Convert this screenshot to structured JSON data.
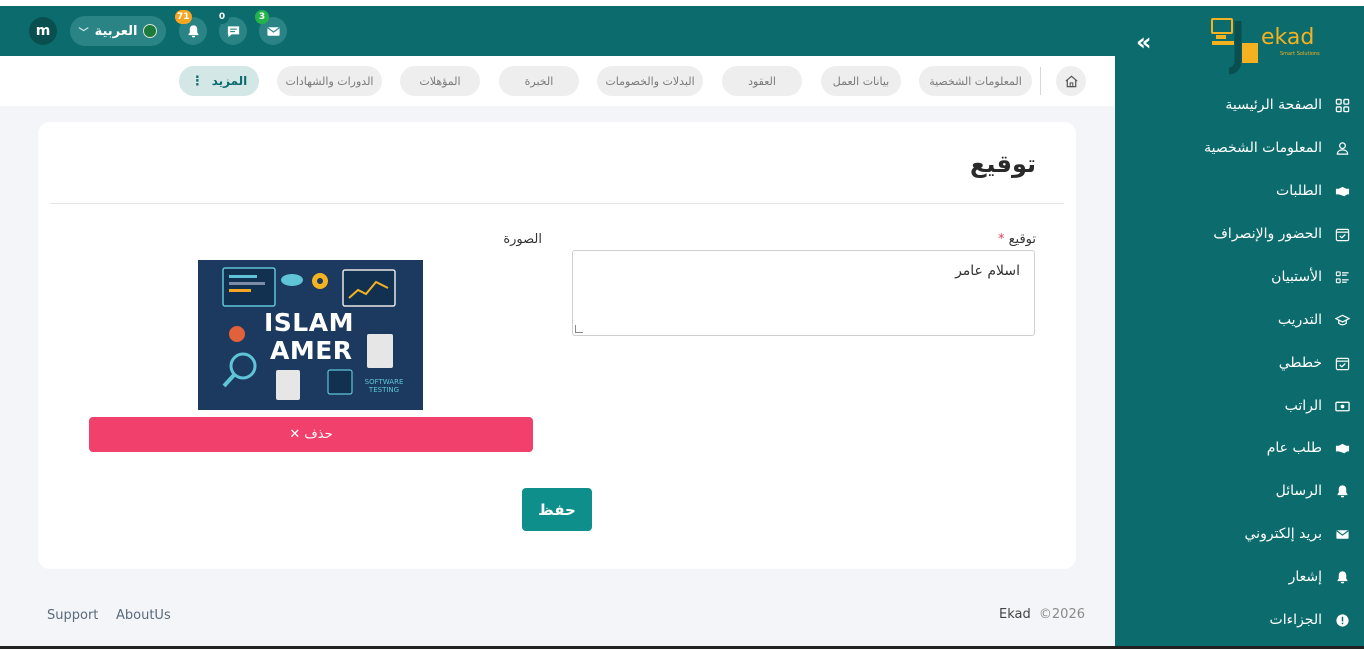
{
  "header": {
    "avatar_letter": "m",
    "language": "العربية",
    "notifications": [
      {
        "name": "notifications",
        "count": "71",
        "badge_color": "#f5a623"
      },
      {
        "name": "messages",
        "count": "0",
        "badge_color": "#0c6b6c"
      },
      {
        "name": "mail",
        "count": "3",
        "badge_color": "#23b34a"
      }
    ]
  },
  "tabs": {
    "home_icon": "home-icon",
    "items": [
      "المعلومات الشخصية",
      "بيانات العمل",
      "العقود",
      "البدلات والخصومات",
      "الخبرة",
      "المؤهلات",
      "الدورات والشهادات"
    ],
    "more_label": "المزيد"
  },
  "card": {
    "title": "توقيع",
    "signature_label": "توقيع",
    "required_mark": "*",
    "signature_value": "اسلام عامر",
    "image_label": "الصورة",
    "image_text_line1": "ISLAM",
    "image_text_line2": "AMER",
    "image_text_caption": "SOFTWARE TESTING",
    "delete_label": "حذف",
    "save_label": "حفظ"
  },
  "footer": {
    "support": "Support",
    "about": "AboutUs",
    "brand": "Ekad",
    "copyright": "©2026"
  },
  "sidebar": {
    "logo_text": "ekad",
    "logo_subtext": "Smart Solutions",
    "items": [
      {
        "label": "الصفحة الرئيسية",
        "icon": "grid-icon"
      },
      {
        "label": "المعلومات الشخصية",
        "icon": "user-icon"
      },
      {
        "label": "الطلبات",
        "icon": "handshake-icon"
      },
      {
        "label": "الحضور والإنصراف",
        "icon": "calendar-check-icon"
      },
      {
        "label": "الأستبيان",
        "icon": "list-icon"
      },
      {
        "label": "التدريب",
        "icon": "graduation-cap-icon"
      },
      {
        "label": "خططي",
        "icon": "calendar-check-icon"
      },
      {
        "label": "الراتب",
        "icon": "money-icon"
      },
      {
        "label": "طلب عام",
        "icon": "handshake-icon"
      },
      {
        "label": "الرسائل",
        "icon": "bell-icon"
      },
      {
        "label": "بريد إلكتروني",
        "icon": "envelope-icon"
      },
      {
        "label": "إشعار",
        "icon": "bell-icon"
      },
      {
        "label": "الجزاءات",
        "icon": "alert-icon"
      }
    ]
  },
  "colors": {
    "primary": "#0c6b6c",
    "accent": "#0f8f8c",
    "danger": "#f0406b",
    "logo": "#f5b220"
  }
}
